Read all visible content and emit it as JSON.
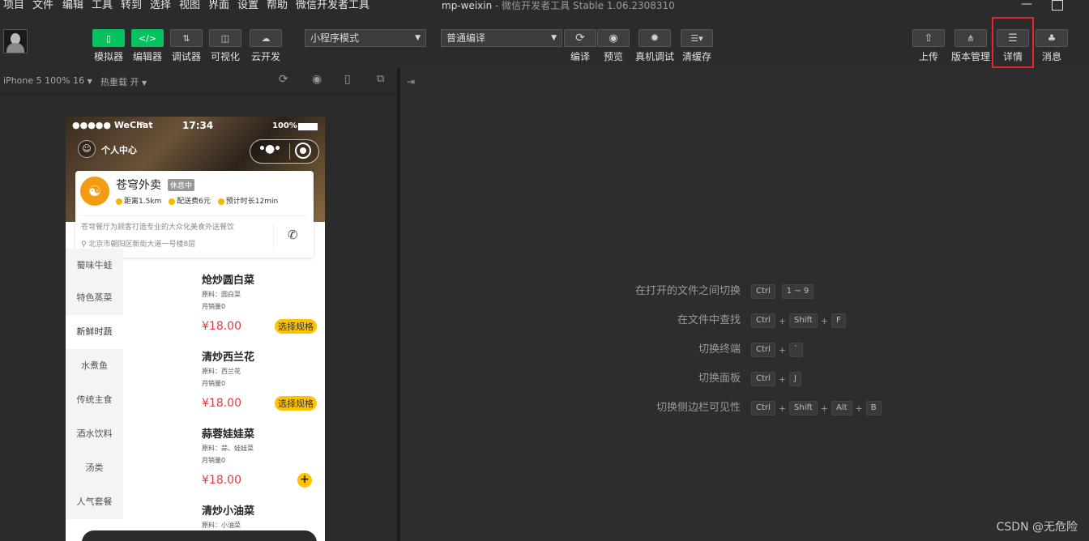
{
  "menubar": {
    "items": [
      "项目",
      "文件",
      "编辑",
      "工具",
      "转到",
      "选择",
      "视图",
      "界面",
      "设置",
      "帮助",
      "微信开发者工具"
    ],
    "title_app": "mp-weixin",
    "title_rest": " - 微信开发者工具 Stable 1.06.2308310"
  },
  "toolbar": {
    "left": [
      {
        "label": "模拟器",
        "icon": "phone-icon"
      },
      {
        "label": "编辑器",
        "icon": "code-icon"
      },
      {
        "label": "调试器",
        "icon": "debug-icon"
      },
      {
        "label": "可视化",
        "icon": "layout-icon"
      },
      {
        "label": "云开发",
        "icon": "cloud-icon"
      }
    ],
    "mode_select": "小程序模式",
    "compile_select": "普通编译",
    "mid": [
      {
        "label": "编译",
        "icon": "refresh-icon"
      },
      {
        "label": "预览",
        "icon": "eye-icon"
      },
      {
        "label": "真机调试",
        "icon": "bug-icon"
      },
      {
        "label": "清缓存",
        "icon": "layers-icon"
      }
    ],
    "right": [
      {
        "label": "上传",
        "icon": "upload-icon"
      },
      {
        "label": "版本管理",
        "icon": "branch-icon"
      },
      {
        "label": "详情",
        "icon": "menu-icon"
      },
      {
        "label": "消息",
        "icon": "bell-icon"
      }
    ]
  },
  "simulator": {
    "device": "iPhone 5 100% 16",
    "hot_reload": "热重载 开"
  },
  "phone": {
    "carrier": "●●●●● WeChat",
    "time": "17:34",
    "battery": "100%",
    "nav_title": "个人中心",
    "shop_name": "苍穹外卖",
    "shop_status": "休息中",
    "distance": "距离1.5km",
    "delivery_fee": "配送费6元",
    "eta": "预计时长12min",
    "desc": "苍穹餐厅为顾客打造专业的大众化美食外送餐饮",
    "address": "北京市朝阳区新街大道一号楼8层",
    "categories": [
      "蜀味牛蛙",
      "特色蒸菜",
      "新鲜时蔬",
      "水煮鱼",
      "传统主食",
      "酒水饮料",
      "汤类",
      "人气套餐"
    ],
    "dishes": [
      {
        "name": "炝炒圆白菜",
        "ingredient": "原料：圆白菜",
        "sales": "月销量0",
        "price": "¥18.00",
        "action": "选择规格"
      },
      {
        "name": "清炒西兰花",
        "ingredient": "原料：西兰花",
        "sales": "月销量0",
        "price": "¥18.00",
        "action": "选择规格"
      },
      {
        "name": "蒜蓉娃娃菜",
        "ingredient": "原料：蒜、娃娃菜",
        "sales": "月销量0",
        "price": "¥18.00",
        "action": "+"
      },
      {
        "name": "清炒小油菜",
        "ingredient": "原料：小油菜"
      }
    ]
  },
  "shortcuts": [
    {
      "label": "在打开的文件之间切换",
      "keys": [
        "Ctrl",
        "1 ~ 9"
      ]
    },
    {
      "label": "在文件中查找",
      "keys": [
        "Ctrl",
        "Shift",
        "F"
      ]
    },
    {
      "label": "切换终端",
      "keys": [
        "Ctrl",
        "`"
      ]
    },
    {
      "label": "切换面板",
      "keys": [
        "Ctrl",
        "J"
      ]
    },
    {
      "label": "切换侧边栏可见性",
      "keys": [
        "Ctrl",
        "Shift",
        "Alt",
        "B"
      ]
    }
  ],
  "watermark": "CSDN @无危险"
}
